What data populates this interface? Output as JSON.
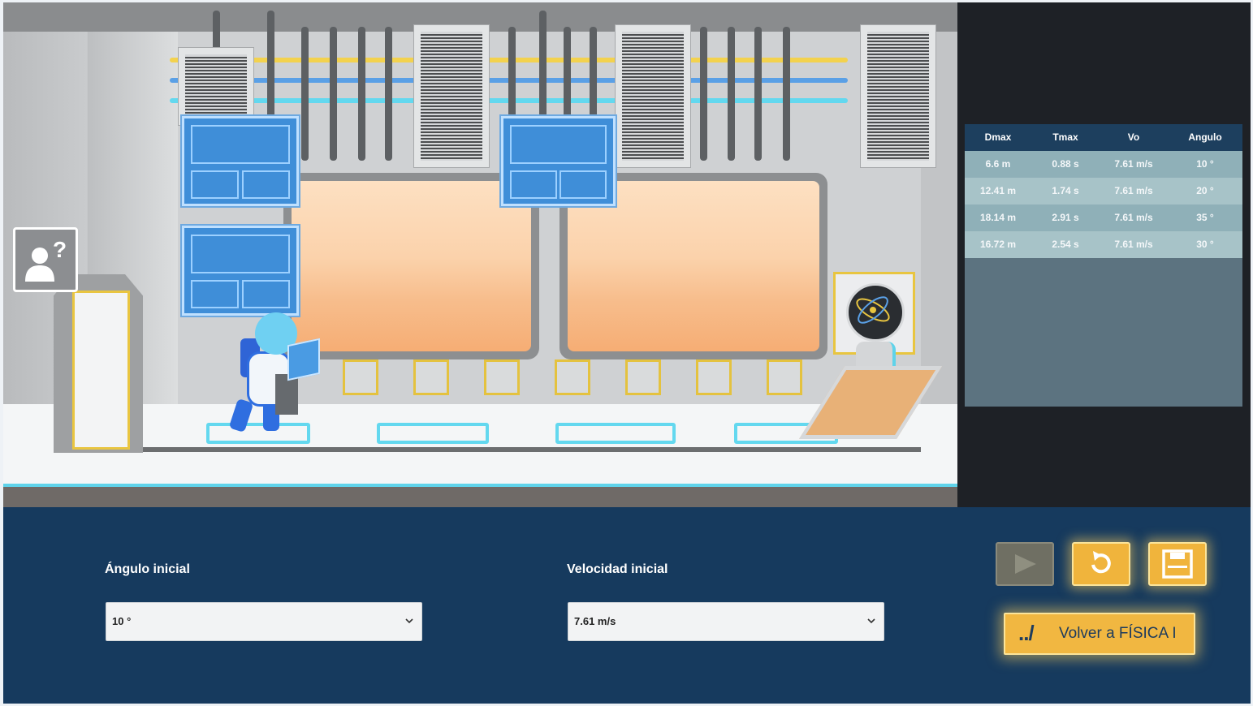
{
  "table": {
    "headers": [
      "Dmax",
      "Tmax",
      "Vo",
      "Angulo"
    ],
    "rows": [
      [
        "6.6 m",
        "0.88 s",
        "7.61 m/s",
        "10 °"
      ],
      [
        "12.41 m",
        "1.74 s",
        "7.61 m/s",
        "20 °"
      ],
      [
        "18.14 m",
        "2.91 s",
        "7.61 m/s",
        "35 °"
      ],
      [
        "16.72 m",
        "2.54 s",
        "7.61 m/s",
        "30 °"
      ]
    ]
  },
  "controls": {
    "angle_label": "Ángulo inicial",
    "angle_value": "10 °",
    "velocity_label": "Velocidad inicial",
    "velocity_value": "7.61 m/s",
    "back_icon": "../",
    "back_label": "Volver a FÍSICA I"
  },
  "icons": {
    "help": "help-person-icon",
    "play": "play-icon",
    "reset": "reset-icon",
    "save": "save-icon",
    "dropdown": "chevron-down-icon"
  },
  "colors": {
    "accent": "#f0b43c",
    "panel": "#163a5e",
    "table_header": "#1d3f5e",
    "row_odd": "#8fb0b8",
    "row_even": "#a7c3c8",
    "disabled": "#6f6f63"
  }
}
